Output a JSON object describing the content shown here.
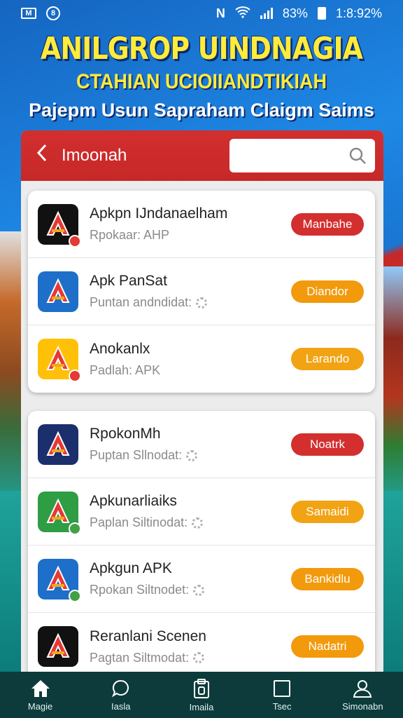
{
  "status_bar": {
    "battery": "83%",
    "time": "1:8:92%"
  },
  "header": {
    "title": "ANILGROP UINDNAGIA",
    "subtitle": "CTAHIAN UCIOIIANDTIKIAH",
    "tagline": "Pajepm Usun Sapraham Claigm Saims"
  },
  "appbar": {
    "title": "Imoonah",
    "search_placeholder": ""
  },
  "card1": [
    {
      "name": "Apkpn IJndanaelham",
      "sub": "Rpokaar: AHP",
      "button": "Manbahe",
      "button_color": "#d32f2f",
      "icon_bg": "#111111",
      "badge": "#e53935",
      "icon": "red-a-logo-icon"
    },
    {
      "name": "Apk PanSat",
      "sub": "Puntan andndidat:",
      "button": "Diandor",
      "button_color": "#f29a0c",
      "icon_bg": "#1e6fc9",
      "badge": "",
      "icon": "orange-a-logo-icon"
    },
    {
      "name": "Anokanlx",
      "sub": "Padlah: APK",
      "button": "Larando",
      "button_color": "#f2a313",
      "icon_bg": "#ffc107",
      "badge": "#e53935",
      "icon": "emblem-logo-icon"
    }
  ],
  "card2": [
    {
      "name": "RpokonMh",
      "sub": "Puptan Sllnodat:",
      "button": "Noatrk",
      "button_color": "#d32f2f",
      "icon_bg": "#1a2f6b",
      "badge": "",
      "icon": "crest-logo-icon"
    },
    {
      "name": "Apkunarliaiks",
      "sub": "Paplan Siltinodat:",
      "button": "Samaidi",
      "button_color": "#f2a313",
      "icon_bg": "#2e9d44",
      "badge": "#43a047",
      "icon": "green-a-logo-icon"
    },
    {
      "name": "Apkgun APK",
      "sub": "Rpokan Siltnodet:",
      "button": "Bankidlu",
      "button_color": "#f29a0c",
      "icon_bg": "#1e6fc9",
      "badge": "#43a047",
      "icon": "red-a-blue-logo-icon"
    },
    {
      "name": "Reranlani Scenen",
      "sub": "Pagtan Siltmodat:",
      "button": "Nadatri",
      "button_color": "#f29a0c",
      "icon_bg": "#111111",
      "badge": "",
      "icon": "ak-logo-icon"
    }
  ],
  "nav": [
    {
      "label": "Magie",
      "icon": "home-icon"
    },
    {
      "label": "Iasla",
      "icon": "chat-icon"
    },
    {
      "label": "Imaila",
      "icon": "clipboard-icon"
    },
    {
      "label": "Tsec",
      "icon": "square-icon"
    },
    {
      "label": "Simonabn",
      "icon": "profile-icon"
    }
  ]
}
